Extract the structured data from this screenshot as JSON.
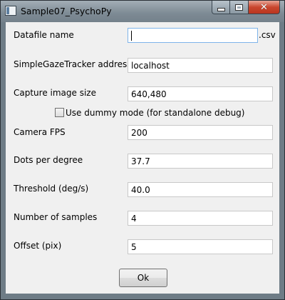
{
  "window": {
    "title": "Sample07_PsychoPy",
    "icon": "app-window-icon",
    "controls": {
      "minimize": "minimize-icon",
      "maximize": "maximize-icon",
      "close": "close-icon"
    }
  },
  "form": {
    "datafile": {
      "label": "Datafile name",
      "value": "",
      "suffix": ".csv"
    },
    "tracker_address": {
      "label": "SimpleGazeTracker address",
      "value": "localhost"
    },
    "capture_size": {
      "label": "Capture image size",
      "value": "640,480"
    },
    "dummy_mode": {
      "label": "Use dummy mode (for standalone debug)",
      "checked": false
    },
    "camera_fps": {
      "label": "Camera FPS",
      "value": "200"
    },
    "dots_per_degree": {
      "label": "Dots per degree",
      "value": "37.7"
    },
    "threshold": {
      "label": "Threshold (deg/s)",
      "value": "40.0"
    },
    "num_samples": {
      "label": "Number of samples",
      "value": "4"
    },
    "offset": {
      "label": "Offset (pix)",
      "value": "5"
    }
  },
  "buttons": {
    "ok": "Ok"
  }
}
